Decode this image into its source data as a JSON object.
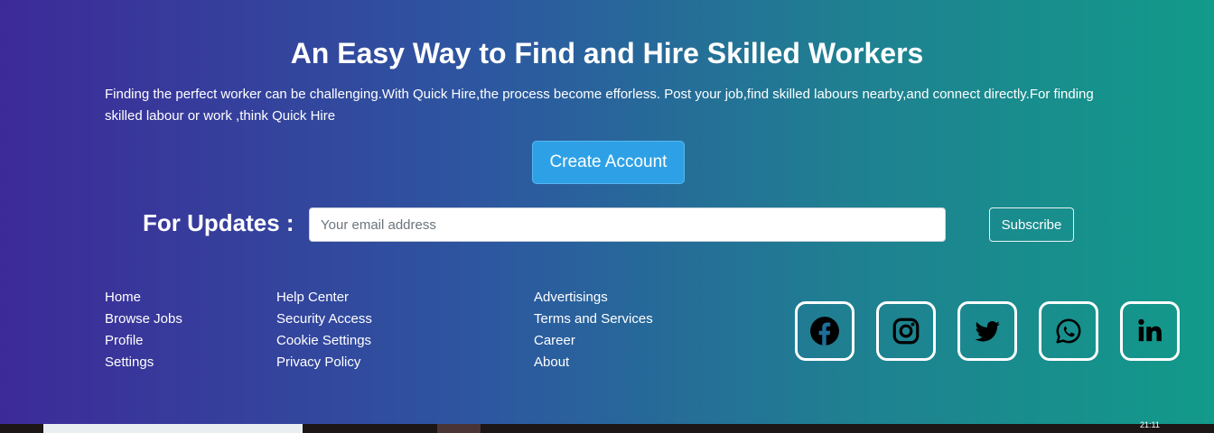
{
  "hero": {
    "title": "An Easy Way to Find and Hire Skilled Workers",
    "description": "Finding the perfect worker can be challenging.With Quick Hire,the process become efforless. Post your job,find skilled labours nearby,and connect directly.For finding skilled labour or work ,think Quick Hire",
    "create_account_label": "Create Account"
  },
  "updates": {
    "label": "For Updates :",
    "email_placeholder": "Your email address",
    "subscribe_label": "Subscribe"
  },
  "footer": {
    "col1": [
      "Home",
      "Browse Jobs",
      "Profile",
      "Settings"
    ],
    "col2": [
      "Help Center",
      "Security Access",
      "Cookie Settings",
      "Privacy Policy"
    ],
    "col3": [
      "Advertisings",
      "Terms and Services",
      "Career",
      "About"
    ]
  },
  "socials": [
    "facebook-icon",
    "instagram-icon",
    "twitter-icon",
    "whatsapp-icon",
    "linkedin-icon"
  ],
  "taskbar": {
    "clock": "21:11"
  },
  "colors": {
    "gradient_start": "#3d2a99",
    "gradient_end": "#129a8a",
    "button_blue": "#2ea1e6"
  }
}
